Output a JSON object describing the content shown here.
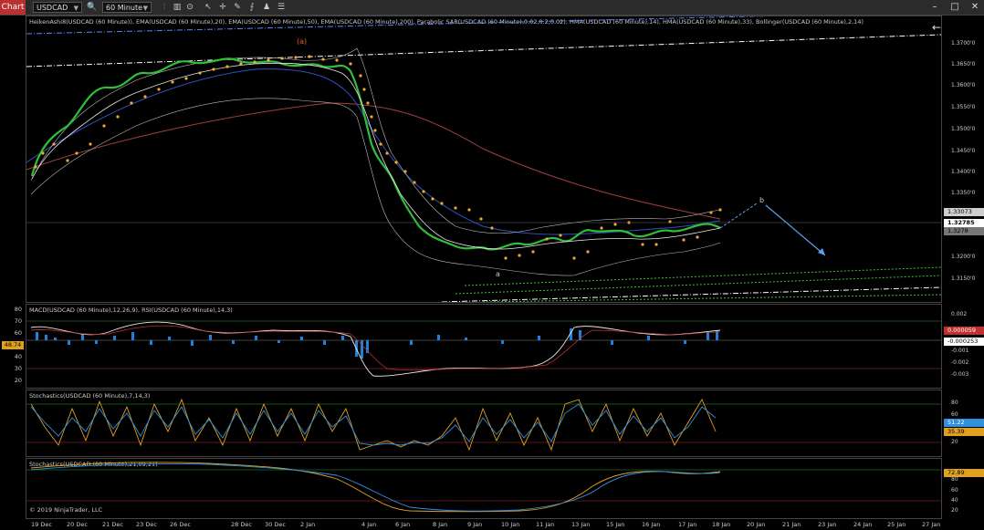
{
  "window": {
    "tab_label": "Chart",
    "instrument": "USDCAD",
    "period": "60 Minute"
  },
  "panels": {
    "price": {
      "indicators_label": "HeikenAshi8(USDCAD (60 Minute)), EMA(USDCAD (60 Minute),20), EMA(USDCAD (60 Minute),50), EMA(USDCAD (60 Minute),200), Parabolic SAR(USDCAD (60 Minute),0.02,0.2,0.02), HMA(USDCAD (60 Minute),14), HMA(USDCAD (60 Minute),33), Bollinger(USDCAD (60 Minute),2,14)",
      "wave_label_a_paren": "(a)",
      "wave_label_a": "a",
      "wave_label_b": "b",
      "axis_ticks": [
        "1.3700'0",
        "1.3650'0",
        "1.3600'0",
        "1.3550'0",
        "1.3500'0",
        "1.3450'0",
        "1.3400'0",
        "1.3350'0",
        "1.3300'0",
        "1.3250'0",
        "1.3200'0",
        "1.3150'0"
      ],
      "price_boxes": [
        "1.33073",
        "1.32785",
        "1.3278"
      ]
    },
    "macd_rsi": {
      "indicators_label": "MACD(USDCAD (60 Minute),12,26,9), RSI(USDCAD (60 Minute),14,3)",
      "left_ticks": [
        "80",
        "70",
        "60",
        "50",
        "40",
        "30",
        "20"
      ],
      "left_box": "48.74",
      "right_ticks": [
        "0.002",
        "0.001",
        "0",
        "-0.001",
        "-0.002",
        "-0.003"
      ],
      "right_boxes": [
        "0.000059",
        "-0.000253"
      ]
    },
    "stoch1": {
      "indicators_label": "Stochastics(USDCAD (60 Minute),7,14,3)",
      "right_ticks": [
        "80",
        "60",
        "40",
        "20"
      ],
      "right_boxes": [
        "51.22",
        "35.39"
      ]
    },
    "stoch2": {
      "indicators_label": "Stochastics(USDCAD (60 Minute),21,09,21)",
      "copyright": "© 2019 NinjaTrader, LLC",
      "right_ticks": [
        "80",
        "60",
        "40",
        "20"
      ],
      "right_box": "72.89"
    }
  },
  "x_axis": [
    "19 Dec",
    "20 Dec",
    "21 Dec",
    "23 Dec",
    "26 Dec",
    "28 Dec",
    "30 Dec",
    "2 Jan",
    "4 Jan",
    "6 Jan",
    "8 Jan",
    "9 Jan",
    "10 Jan",
    "11 Jan",
    "13 Jan",
    "15 Jan",
    "16 Jan",
    "17 Jan",
    "18 Jan",
    "20 Jan",
    "21 Jan",
    "23 Jan",
    "24 Jan",
    "25 Jan",
    "27 Jan"
  ],
  "colors": {
    "accent": "#b83030",
    "heiken_up": "#2fbf3a",
    "heiken_down": "#c83030",
    "sar": "#f0a830",
    "ema20": "#e8e8e8",
    "ema50": "#3050c0",
    "ema200": "#a04040",
    "projection": "#5aa0f0",
    "channel": "#3fbf3f",
    "stoch_k": "#e0a020",
    "stoch_d": "#3090e0",
    "macd_hist": "#2080e0"
  }
}
